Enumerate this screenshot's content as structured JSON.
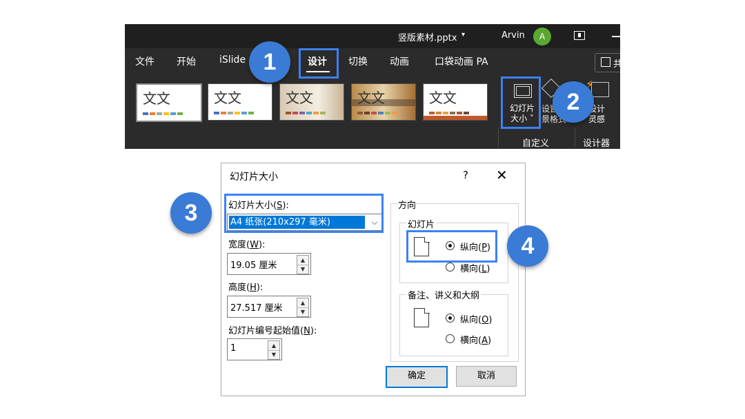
{
  "titlebar": {
    "filename": "竖版素材.pptx",
    "username": "Arvin",
    "avatar_initial": "A"
  },
  "tabs": [
    "文件",
    "开始",
    "iSlide",
    "设计",
    "切换",
    "动画",
    "口袋动画 PA"
  ],
  "share_label": "共",
  "themes": [
    {
      "text": "文文",
      "colors": [
        "#4472c4",
        "#ed7d31",
        "#a5a5a5",
        "#ffc000",
        "#5b9bd5",
        "#70ad47"
      ]
    },
    {
      "text": "文文",
      "colors": [
        "#4472c4",
        "#ed7d31",
        "#a5a5a5",
        "#ffc000",
        "#5b9bd5",
        "#70ad47"
      ]
    },
    {
      "text": "文文",
      "colors": [
        "#a0522d",
        "#c0504d",
        "#8064a2",
        "#4bacc6",
        "#f79646",
        "#9bbb59"
      ]
    },
    {
      "text": "文文",
      "colors": [
        "#8b5a2b",
        "#6b4226",
        "#c0504d",
        "#4f81bd",
        "#9bbb59",
        "#f79646"
      ]
    },
    {
      "text": "文文",
      "colors": [
        "#c0592c",
        "#d9843b",
        "#e0a33a",
        "#7f6f5a",
        "#a05a3c",
        "#6b4c3b"
      ]
    }
  ],
  "ribbon": {
    "slide_size_line1": "幻灯片",
    "slide_size_line2": "大小 ˅",
    "format_bg_line1": "设置",
    "format_bg_line2": "景格式",
    "designer_line1": "设计",
    "designer_line2": "灵感",
    "group_customize": "自定义",
    "group_designer": "设计器"
  },
  "callouts": [
    "1",
    "2",
    "3",
    "4"
  ],
  "dialog": {
    "title": "幻灯片大小",
    "help": "?",
    "close": "✕",
    "slide_size_label": "幻灯片大小(S):",
    "slide_size_value": "A4 纸张(210x297 毫米)",
    "width_label": "宽度(W):",
    "width_value": "19.05 厘米",
    "height_label": "高度(H):",
    "height_value": "27.517 厘米",
    "number_label": "幻灯片编号起始值(N):",
    "number_value": "1",
    "orientation_label": "方向",
    "slides_label": "幻灯片",
    "slides_portrait": "纵向(P)",
    "slides_landscape": "横向(L)",
    "notes_label": "备注、讲义和大纲",
    "notes_portrait": "纵向(O)",
    "notes_landscape": "横向(A)",
    "ok": "确定",
    "cancel": "取消"
  }
}
